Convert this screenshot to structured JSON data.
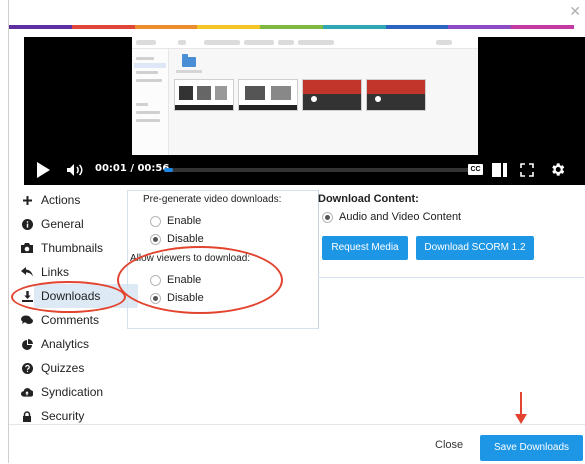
{
  "colors": {
    "rainbow": [
      "#5e2fa0",
      "#e0453a",
      "#eb8d2f",
      "#f2c624",
      "#7cb842",
      "#2fa8b3",
      "#2a63c0",
      "#8b4cc4",
      "#c53aa0"
    ],
    "accent": "#1e96e6",
    "annotation": "#e2442f"
  },
  "dialog": {
    "close_icon": "close-icon"
  },
  "player": {
    "time": "00:01 / 00:56",
    "progress": 0.03,
    "cc_label": "CC"
  },
  "sidebar": {
    "items": [
      {
        "label": "Actions",
        "icon": "plus-icon"
      },
      {
        "label": "General",
        "icon": "info-icon"
      },
      {
        "label": "Thumbnails",
        "icon": "camera-icon"
      },
      {
        "label": "Links",
        "icon": "reply-icon"
      },
      {
        "label": "Downloads",
        "icon": "download-icon",
        "active": true
      },
      {
        "label": "Comments",
        "icon": "comments-icon"
      },
      {
        "label": "Analytics",
        "icon": "pie-chart-icon"
      },
      {
        "label": "Quizzes",
        "icon": "question-icon"
      },
      {
        "label": "Syndication",
        "icon": "cloud-upload-icon"
      },
      {
        "label": "Security",
        "icon": "lock-icon"
      }
    ]
  },
  "pregen": {
    "title": "Pre-generate video downloads:",
    "enable": "Enable",
    "disable": "Disable",
    "selected": "disable"
  },
  "viewers": {
    "title": "Allow viewers to download:",
    "enable": "Enable",
    "disable": "Disable",
    "selected": "disable"
  },
  "download_content": {
    "title": "Download Content:",
    "option": "Audio and Video Content",
    "request_media": "Request Media",
    "download_scorm": "Download SCORM 1.2"
  },
  "footer": {
    "close": "Close",
    "save": "Save Downloads"
  }
}
